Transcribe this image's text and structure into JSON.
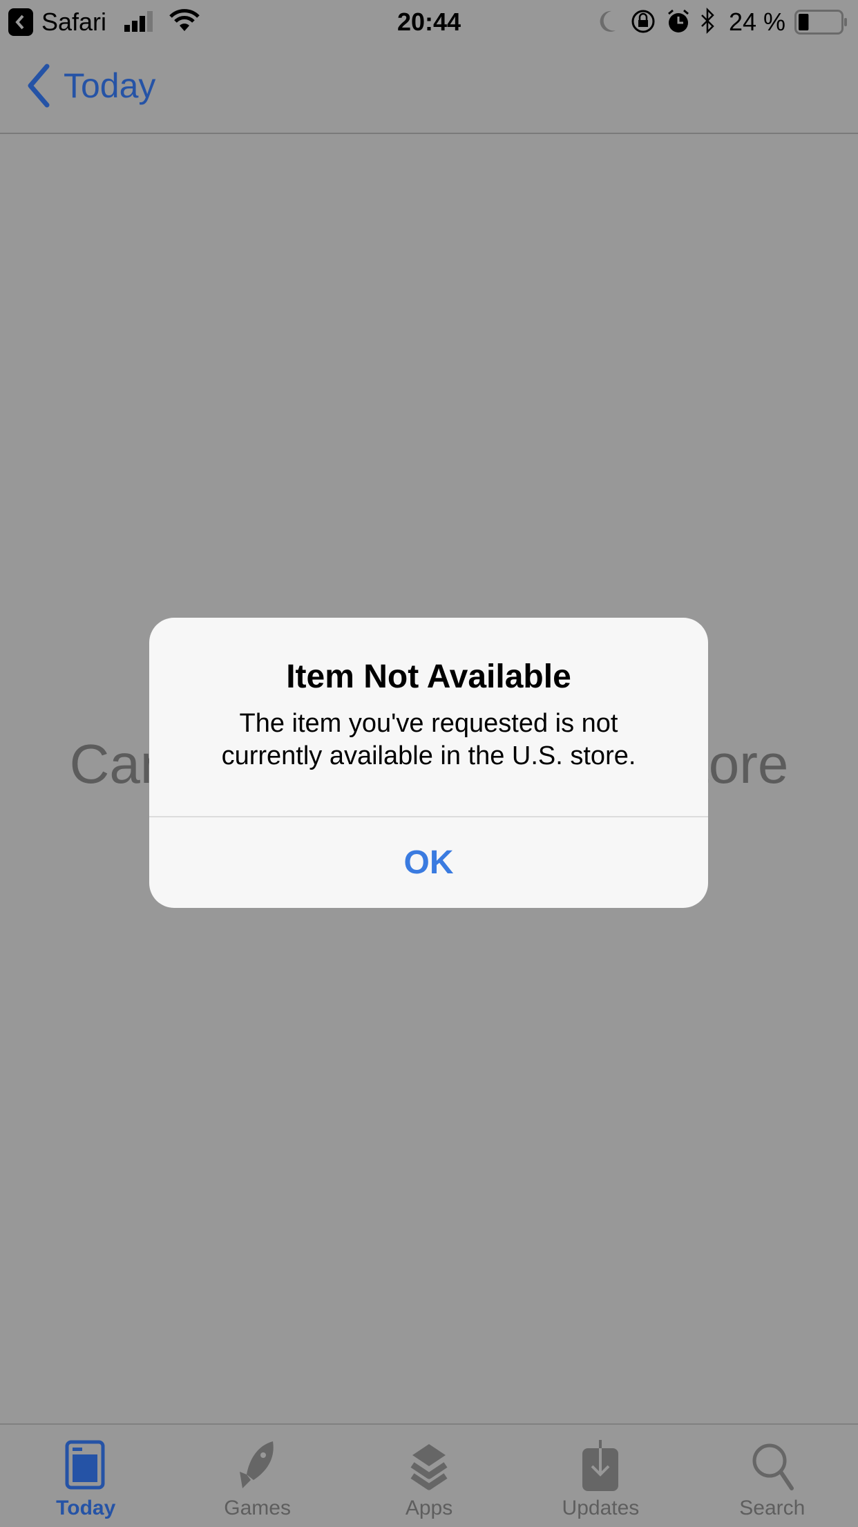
{
  "status_bar": {
    "back_app": "Safari",
    "time": "20:44",
    "battery_percent": "24 %",
    "battery_level": 0.24,
    "icons": [
      "back-app-icon",
      "signal-icon",
      "wifi-icon",
      "moon-icon",
      "rotation-lock-icon",
      "alarm-icon",
      "bluetooth-icon",
      "battery-icon"
    ]
  },
  "nav": {
    "back_label": "Today"
  },
  "background": {
    "message": "Cannot Connect to App Store"
  },
  "alert": {
    "title": "Item Not Available",
    "message_line1": "The item you've requested is not",
    "message_line2": "currently available in the U.S. store.",
    "ok_label": "OK"
  },
  "tabs": [
    {
      "label": "Today",
      "icon": "today-icon",
      "active": true
    },
    {
      "label": "Games",
      "icon": "rocket-icon"
    },
    {
      "label": "Apps",
      "icon": "layers-icon"
    },
    {
      "label": "Updates",
      "icon": "download-icon"
    },
    {
      "label": "Search",
      "icon": "search-icon"
    }
  ],
  "colors": {
    "accent": "#2553a6",
    "alert_button": "#3a7be0",
    "dim_background": "#989898"
  }
}
